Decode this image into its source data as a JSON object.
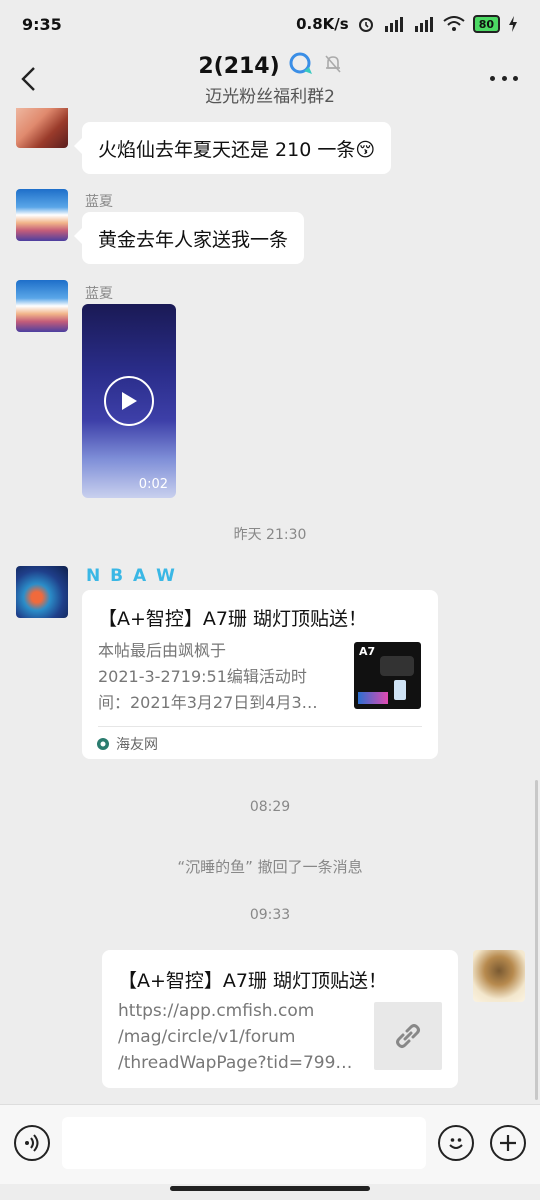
{
  "status_bar": {
    "time": "9:35",
    "speed": "0.8K/s",
    "battery": "80"
  },
  "header": {
    "title": "2(214)",
    "subtitle": "迈光粉丝福利群2"
  },
  "messages": [
    {
      "sender": "",
      "text": "火焰仙去年夏天还是 210 一条😚"
    },
    {
      "sender": "蓝夏",
      "text": "黄金去年人家送我一条"
    },
    {
      "sender": "蓝夏",
      "video_duration": "0:02"
    }
  ],
  "timestamps": [
    "昨天 21:30",
    "08:29",
    "09:33"
  ],
  "share_card": {
    "sender": "N B A W",
    "title": "【A+智控】A7珊 瑚灯顶贴送！",
    "desc_lines": [
      "本帖最后由飒枫于",
      "2021-3-2719:51编辑活动时",
      "间：2021年3月27日到4月3…"
    ],
    "thumb_label": "A7",
    "source": "海友网"
  },
  "recall_notice": "“沉睡的鱼” 撤回了一条消息",
  "my_link": {
    "title": "【A+智控】A7珊 瑚灯顶贴送！",
    "url_lines": [
      "https://app.cmfish.com",
      "/mag/circle/v1/forum",
      "/threadWapPage?tid=799…"
    ]
  },
  "input": {
    "placeholder": ""
  },
  "colors": {
    "background": "#ededed",
    "bubble": "#ffffff",
    "sender_nbaw": "#3ab7e5",
    "battery": "#4cd964"
  }
}
